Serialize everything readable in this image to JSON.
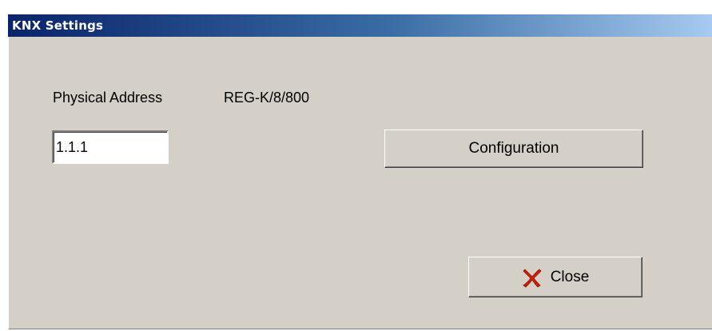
{
  "window": {
    "title": "KNX Settings"
  },
  "device": {
    "physical_address_label": "Physical Address",
    "model": "REG-K/8/800",
    "physical_address_value": "1.1.1"
  },
  "buttons": {
    "configuration_label": "Configuration",
    "close_label": "Close"
  },
  "icons": {
    "close": "close-x-icon"
  },
  "colors": {
    "title_gradient_start": "#0a246a",
    "title_gradient_end": "#a6caf0",
    "dialog_background": "#d4d0c8",
    "close_icon_red": "#d81e06"
  }
}
